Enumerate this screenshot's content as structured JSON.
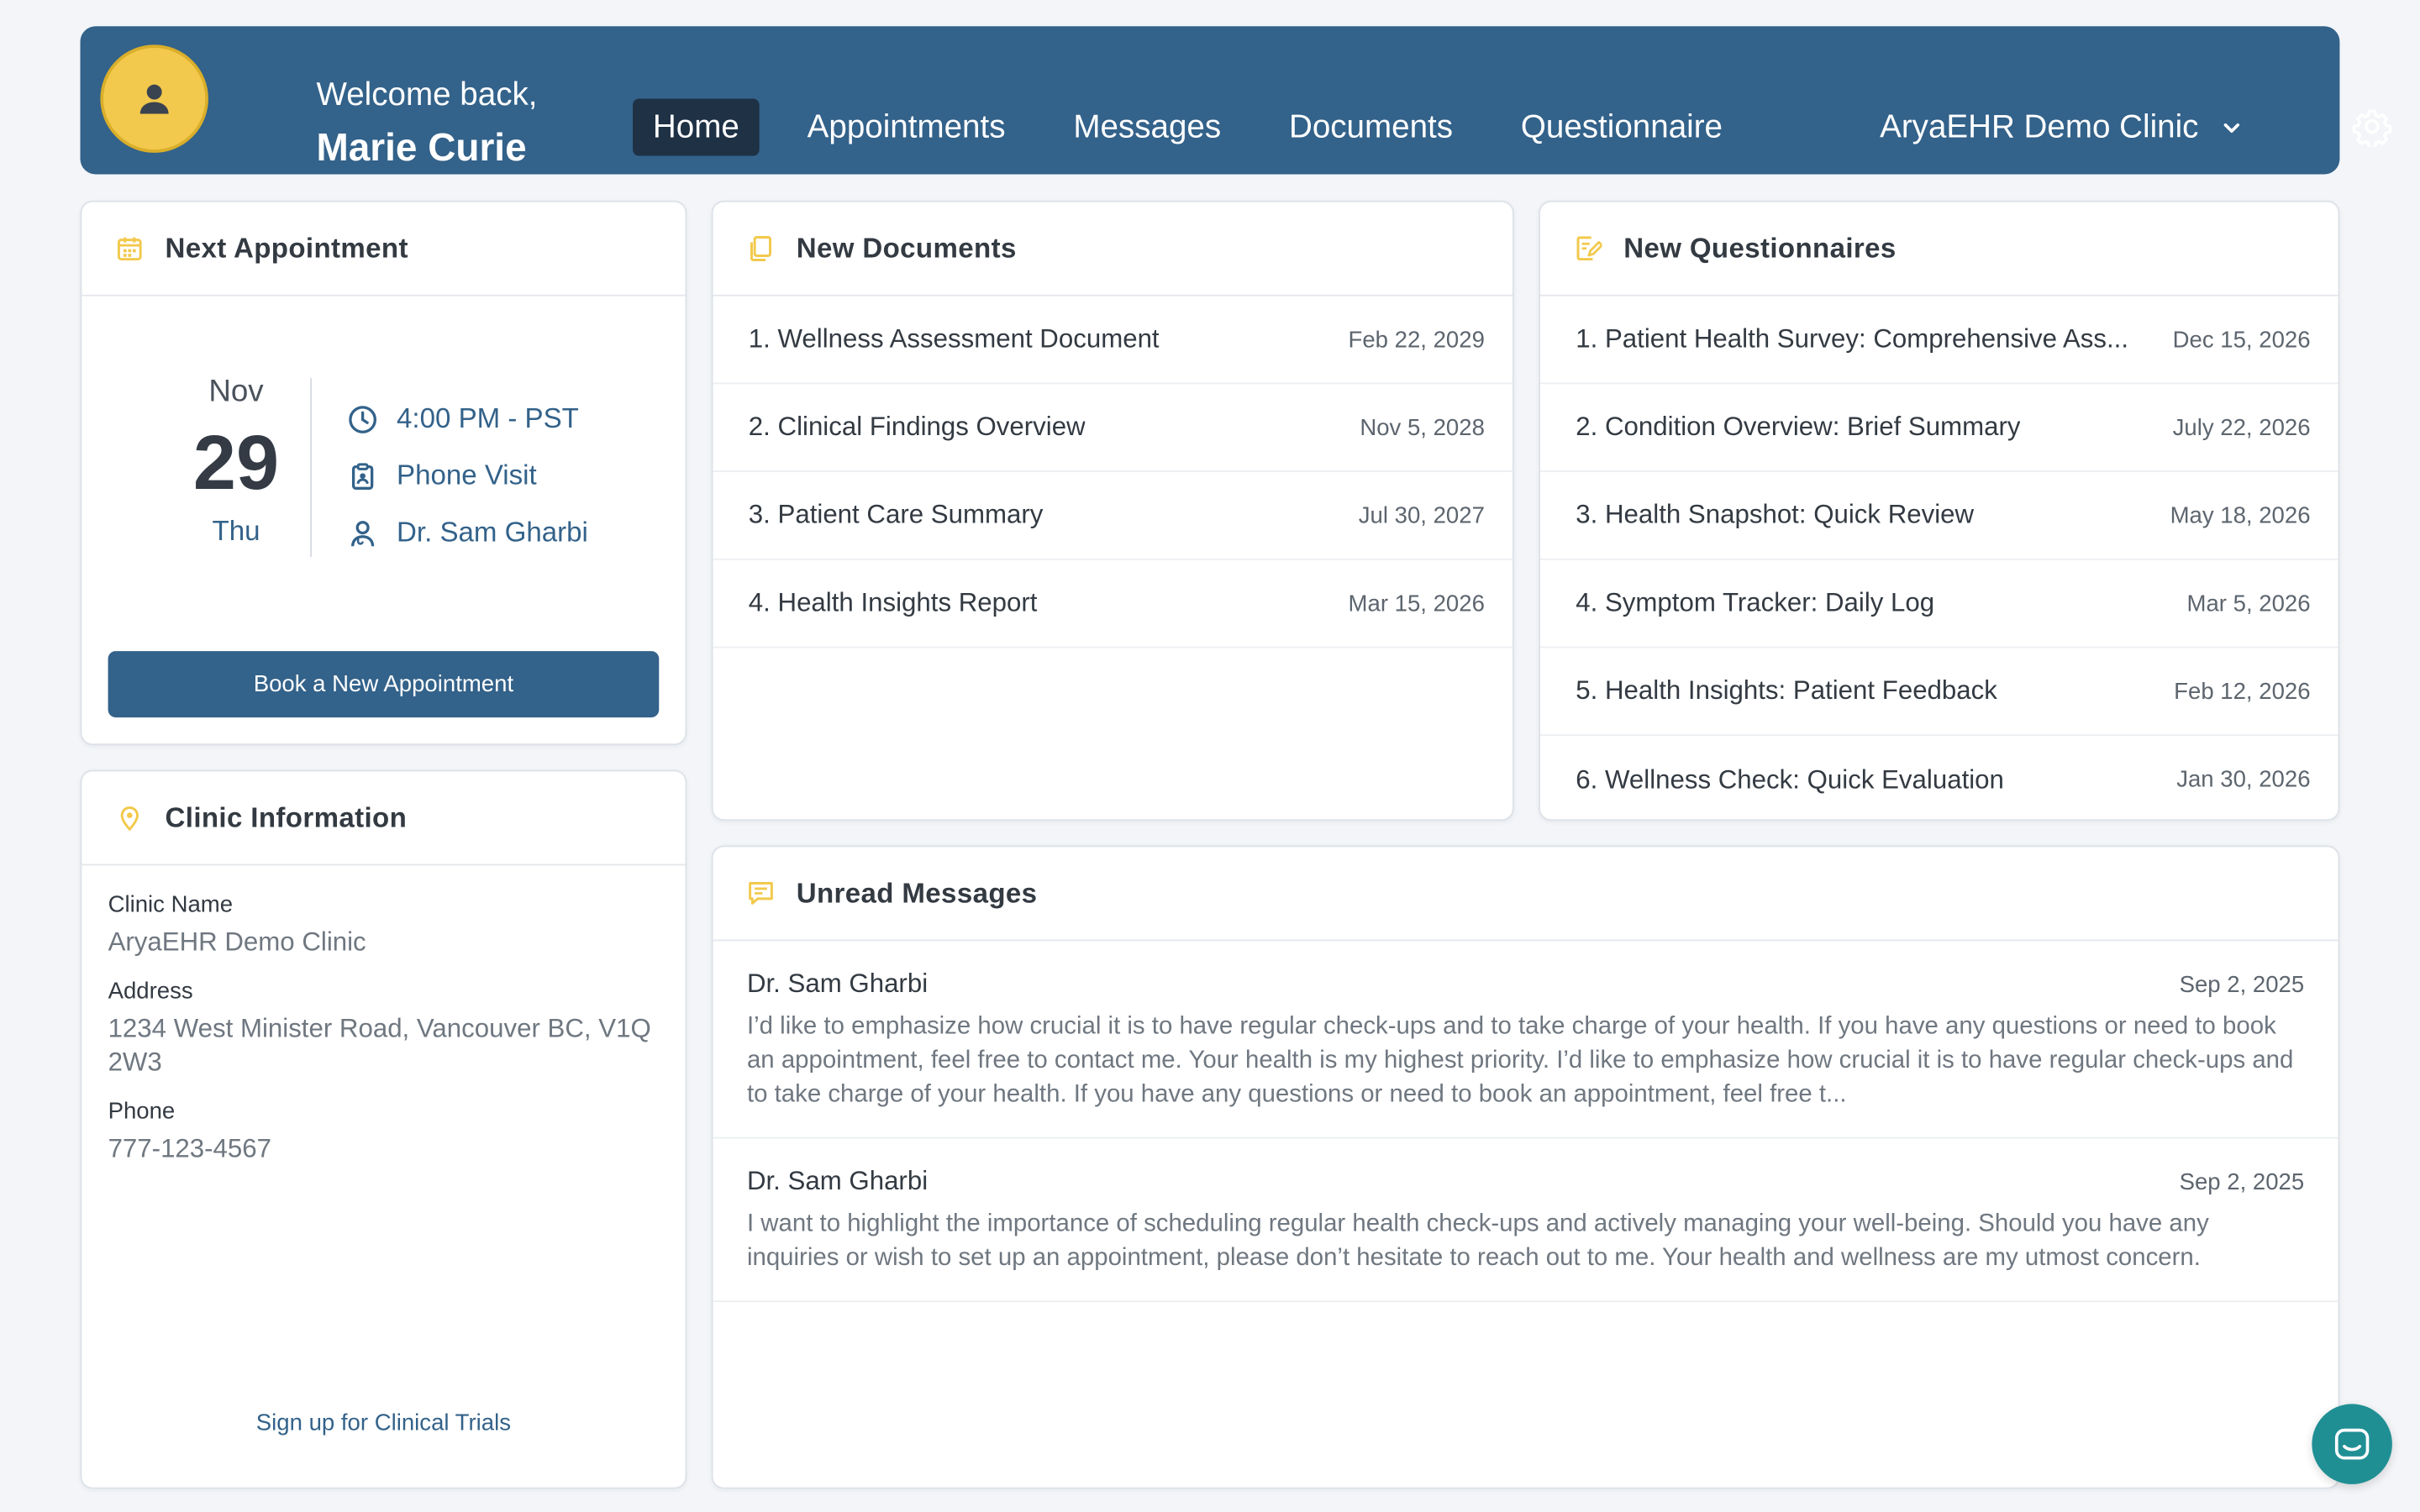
{
  "header": {
    "welcome": "Welcome back,",
    "user_name": "Marie Curie",
    "nav": [
      {
        "label": "Home",
        "active": true
      },
      {
        "label": "Appointments",
        "active": false
      },
      {
        "label": "Messages",
        "active": false
      },
      {
        "label": "Documents",
        "active": false
      },
      {
        "label": "Questionnaire",
        "active": false
      }
    ],
    "clinic_selected": "AryaEHR Demo Clinic"
  },
  "next_appointment": {
    "title": "Next Appointment",
    "month": "Nov",
    "day": "29",
    "weekday": "Thu",
    "time": "4:00 PM - PST",
    "type": "Phone Visit",
    "doctor": "Dr. Sam Gharbi",
    "book_button": "Book a New Appointment"
  },
  "clinic_info": {
    "title": "Clinic Information",
    "name_label": "Clinic Name",
    "name": "AryaEHR Demo Clinic",
    "address_label": "Address",
    "address": "1234 West Minister Road, Vancouver BC, V1Q 2W3",
    "phone_label": "Phone",
    "phone": "777-123-4567",
    "trials_link": "Sign up for Clinical Trials"
  },
  "documents": {
    "title": "New Documents",
    "items": [
      {
        "name": "1. Wellness Assessment Document",
        "date": "Feb 22, 2029"
      },
      {
        "name": "2. Clinical Findings Overview",
        "date": "Nov 5, 2028"
      },
      {
        "name": "3. Patient Care Summary",
        "date": "Jul 30, 2027"
      },
      {
        "name": "4. Health Insights Report",
        "date": "Mar 15, 2026"
      }
    ]
  },
  "questionnaires": {
    "title": "New Questionnaires",
    "items": [
      {
        "name": "1. Patient Health Survey: Comprehensive Ass...",
        "date": "Dec 15, 2026"
      },
      {
        "name": "2. Condition Overview: Brief Summary",
        "date": "July 22, 2026"
      },
      {
        "name": "3. Health Snapshot: Quick Review",
        "date": "May 18, 2026"
      },
      {
        "name": "4. Symptom Tracker: Daily Log",
        "date": "Mar 5, 2026"
      },
      {
        "name": "5. Health Insights: Patient Feedback",
        "date": "Feb 12, 2026"
      },
      {
        "name": "6. Wellness Check: Quick Evaluation",
        "date": "Jan 30, 2026"
      }
    ]
  },
  "messages": {
    "title": "Unread Messages",
    "items": [
      {
        "from": "Dr. Sam Gharbi",
        "date": "Sep 2, 2025",
        "body": "I’d like to emphasize how crucial it is to have regular check-ups and to take charge of your health. If you have any questions or need to book an appointment, feel free to contact me. Your health is my highest priority. I’d like to emphasize how crucial it is to have regular check-ups and to take charge of your health. If you have any questions or need to book an appointment, feel free t..."
      },
      {
        "from": "Dr. Sam Gharbi",
        "date": "Sep 2, 2025",
        "body": "I want to highlight the importance of scheduling regular health check-ups and actively managing your well-being. Should you have any inquiries or wish to set up an appointment, please don’t hesitate to reach out to me. Your health and wellness are my utmost concern."
      }
    ]
  },
  "colors": {
    "primary": "#33628a",
    "accent": "#f2c94c",
    "background": "#f3f5f8",
    "chat": "#1f8f94"
  },
  "icons": [
    "user-icon",
    "chevron-down-icon",
    "gear-icon",
    "calendar-icon",
    "clock-icon",
    "clipboard-icon",
    "doctor-icon",
    "location-pin-icon",
    "documents-icon",
    "questionnaire-icon",
    "message-icon",
    "chat-icon"
  ]
}
